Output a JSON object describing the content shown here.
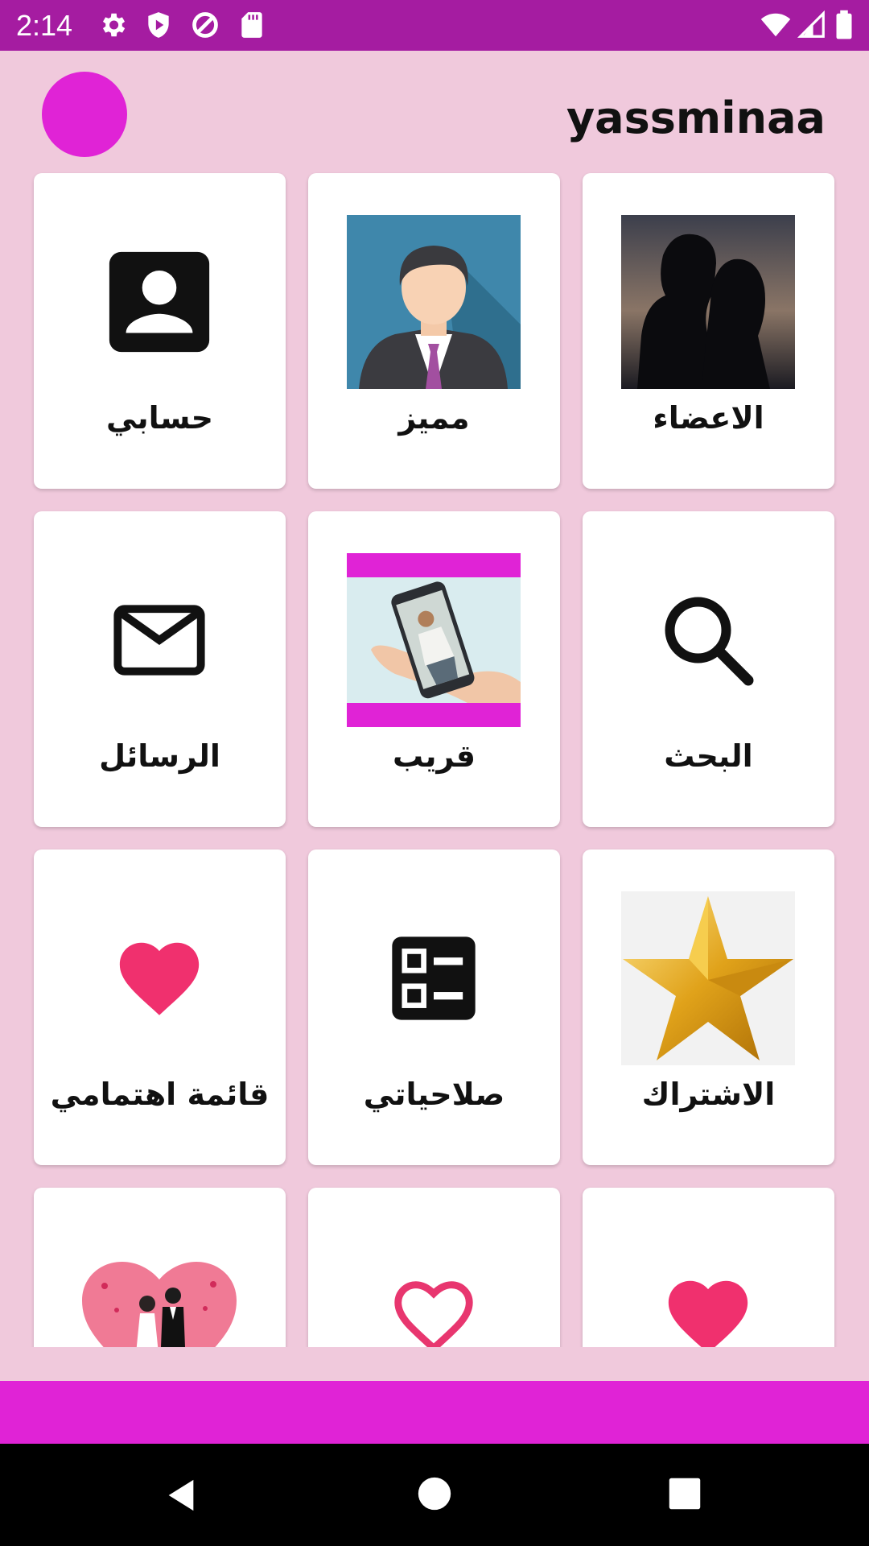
{
  "status_bar": {
    "time": "2:14",
    "left_icons": [
      "settings-icon",
      "shield-icon",
      "data-saver-icon",
      "sd-card-icon"
    ],
    "right_icons": [
      "wifi-icon",
      "signal-icon",
      "battery-icon"
    ]
  },
  "header": {
    "username": "yassminaa",
    "avatar_color": "#e023d6"
  },
  "tiles": [
    {
      "label": "الاعضاء",
      "image": "couple-silhouette-image"
    },
    {
      "label": "مميز",
      "image": "businessman-avatar-image"
    },
    {
      "label": "حسابي",
      "image": "account-box-icon"
    },
    {
      "label": "البحث",
      "image": "search-icon"
    },
    {
      "label": "قريب",
      "image": "phone-in-hand-image"
    },
    {
      "label": "الرسائل",
      "image": "mail-icon"
    },
    {
      "label": "الاشتراك",
      "image": "gold-star-image"
    },
    {
      "label": "صلاحياتي",
      "image": "checklist-icon"
    },
    {
      "label": "قائمة اهتمامي",
      "image": "heart-icon"
    },
    {
      "label": "",
      "image": "heart-icon"
    },
    {
      "label": "",
      "image": "heart-outline-icon"
    },
    {
      "label": "",
      "image": "wedding-couple-image"
    }
  ],
  "colors": {
    "status_bar": "#a51ca1",
    "background": "#f0c9dc",
    "accent": "#e023d6",
    "heart": "#f0306e"
  },
  "nav": [
    "back-icon",
    "home-icon",
    "recents-icon"
  ]
}
